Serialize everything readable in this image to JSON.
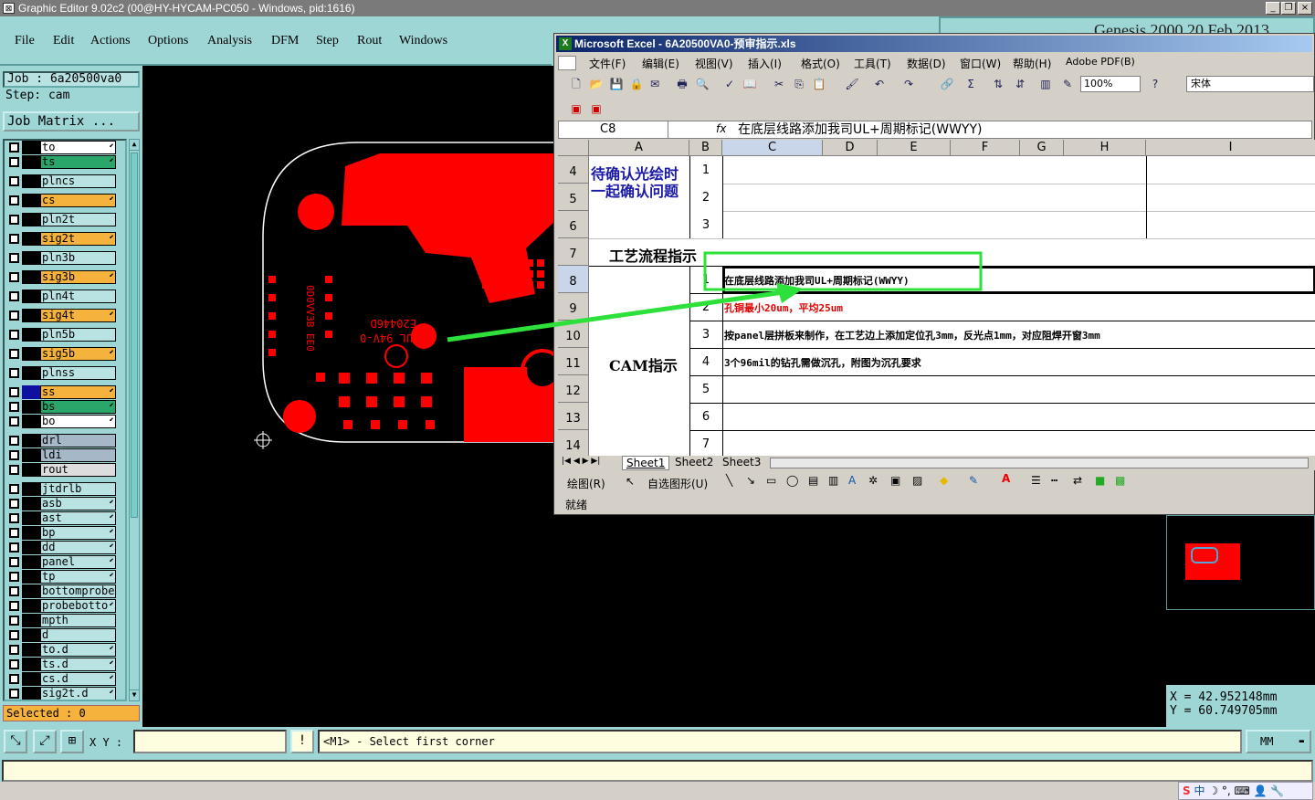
{
  "genesis": {
    "title": "Graphic Editor 9.02c2 (00@HY-HYCAM-PC050 - Windows, pid:1616)",
    "banner": "Genesis 2000  20 Feb 2013",
    "menu": [
      "File",
      "Edit",
      "Actions",
      "Options",
      "Analysis",
      "DFM",
      "Step",
      "Rout",
      "Windows"
    ],
    "job_label": "Job : 6a20500va0",
    "step_label": "Step: cam",
    "job_matrix": "Job Matrix ...",
    "selected": "Selected : 0",
    "layers": [
      {
        "name": "to",
        "color": "#ffffff",
        "arrow": true
      },
      {
        "name": "ts",
        "color": "#2aa66a",
        "arrow": true
      },
      {
        "name": "plncs",
        "color": "#b9e2e2",
        "arrow": false
      },
      {
        "name": "cs",
        "color": "#f5b23c",
        "arrow": true
      },
      {
        "name": "pln2t",
        "color": "#b9e2e2",
        "arrow": false
      },
      {
        "name": "sig2t",
        "color": "#f5b23c",
        "arrow": true
      },
      {
        "name": "pln3b",
        "color": "#b9e2e2",
        "arrow": false
      },
      {
        "name": "sig3b",
        "color": "#f5b23c",
        "arrow": true
      },
      {
        "name": "pln4t",
        "color": "#b9e2e2",
        "arrow": false
      },
      {
        "name": "sig4t",
        "color": "#f5b23c",
        "arrow": true
      },
      {
        "name": "pln5b",
        "color": "#b9e2e2",
        "arrow": false
      },
      {
        "name": "sig5b",
        "color": "#f5b23c",
        "arrow": true
      },
      {
        "name": "plnss",
        "color": "#b9e2e2",
        "arrow": false
      },
      {
        "name": "ss",
        "color": "#f5b23c",
        "arrow": true
      },
      {
        "name": "bs",
        "color": "#2aa66a",
        "arrow": true
      },
      {
        "name": "bo",
        "color": "#ffffff",
        "arrow": true
      },
      {
        "name": "drl",
        "color": "#a6b8c8",
        "arrow": false
      },
      {
        "name": "ldi",
        "color": "#a6b8c8",
        "arrow": false
      },
      {
        "name": "rout",
        "color": "#dddddd",
        "arrow": false
      },
      {
        "name": "jtdrlb",
        "color": "#b9e2e2",
        "arrow": false
      },
      {
        "name": "asb",
        "color": "#b9e2e2",
        "arrow": true
      },
      {
        "name": "ast",
        "color": "#b9e2e2",
        "arrow": true
      },
      {
        "name": "bp",
        "color": "#b9e2e2",
        "arrow": true
      },
      {
        "name": "dd",
        "color": "#b9e2e2",
        "arrow": true
      },
      {
        "name": "panel",
        "color": "#b9e2e2",
        "arrow": true
      },
      {
        "name": "tp",
        "color": "#b9e2e2",
        "arrow": true
      },
      {
        "name": "bottomprobe",
        "color": "#b9e2e2",
        "arrow": false
      },
      {
        "name": "probebotto",
        "color": "#b9e2e2",
        "arrow": true
      },
      {
        "name": "mpth",
        "color": "#b9e2e2",
        "arrow": false
      },
      {
        "name": "d",
        "color": "#b9e2e2",
        "arrow": false
      },
      {
        "name": "to.d",
        "color": "#b9e2e2",
        "arrow": true
      },
      {
        "name": "ts.d",
        "color": "#b9e2e2",
        "arrow": true
      },
      {
        "name": "cs.d",
        "color": "#b9e2e2",
        "arrow": true
      },
      {
        "name": "sig2t.d",
        "color": "#b9e2e2",
        "arrow": true
      }
    ],
    "xy_label": "X Y :",
    "prompt": "<M1> - Select first corner",
    "unit": "MM",
    "coord_x": "X  =  42.952148mm",
    "coord_y": "Y  =  60.749705mm",
    "board_text1": "0D0VV3B  EE0",
    "board_text2": "E20446D",
    "board_text3": "UL 94V-0"
  },
  "excel": {
    "title": "Microsoft Excel - 6A20500VA0-预审指示.xls",
    "menu": [
      "文件(F)",
      "编辑(E)",
      "视图(V)",
      "插入(I)",
      "格式(O)",
      "工具(T)",
      "数据(D)",
      "窗口(W)",
      "帮助(H)",
      "Adobe PDF(B)"
    ],
    "zoom": "100%",
    "font": "宋体",
    "namebox": "C8",
    "fx": "fx",
    "formula": "在底层线路添加我司UL+周期标记(WWYY)",
    "columns": [
      "A",
      "B",
      "C",
      "D",
      "E",
      "F",
      "G",
      "H",
      "I"
    ],
    "rows": [
      "4",
      "5",
      "6",
      "7",
      "8",
      "9",
      "10",
      "11",
      "12",
      "13",
      "14"
    ],
    "pending_label": "待确认光绘时一起确认问题",
    "process_label": "工艺流程指示",
    "cam_label": "CAM指示",
    "pending_nums": [
      "1",
      "2",
      "3"
    ],
    "cam_nums": [
      "1",
      "2",
      "3",
      "4",
      "5",
      "6",
      "7"
    ],
    "cam_items": [
      {
        "text": "在底层线路添加我司UL+周期标记(WWYY)",
        "color": "#000000"
      },
      {
        "text": "孔铜最小20um，平均25um",
        "color": "#e00000"
      },
      {
        "text": "按panel层拼板来制作，在工艺边上添加定位孔3mm，反光点1mm，对应阻焊开窗3mm",
        "color": "#000000"
      },
      {
        "text": "3个96mil的钻孔需做沉孔，附图为沉孔要求",
        "color": "#000000"
      }
    ],
    "sheets": [
      "Sheet1",
      "Sheet2",
      "Sheet3"
    ],
    "draw_label": "绘图(R)",
    "autoshape_label": "自选图形(U)",
    "status": "就绪"
  },
  "taskbar": {
    "ime": "中"
  }
}
